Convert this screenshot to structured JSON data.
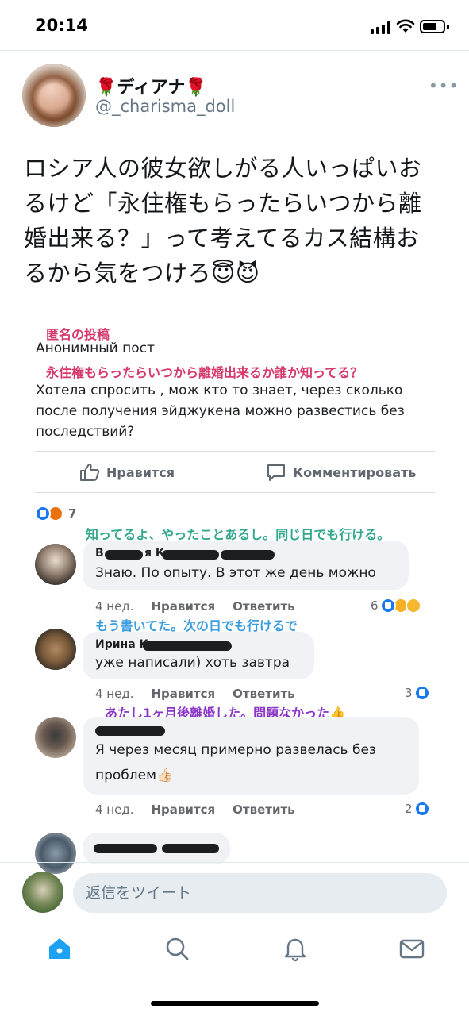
{
  "status": {
    "time": "20:14"
  },
  "tweet": {
    "name": "🌹ディアナ🌹",
    "handle": "@_charisma_doll",
    "more": "•••",
    "text_lines": [
      "ロシア人の彼女欲しがる人いっぱいお",
      "るけど「永住権もらったらいつから離",
      "婚出来る？」って考えてるカス結構お",
      "るから気をつけろ😇😈"
    ]
  },
  "embedded": {
    "anno_title": "匿名の投稿",
    "post_label": "Анонимный пост",
    "anno_question": "永住権もらったらいつから離婚出来るか誰か知ってる？",
    "post_lines": [
      "Хотела спросить , мож кто то знает, через сколько",
      "после получения эйджукена можно развестись без",
      "последствий?"
    ],
    "like_action": "Нравится",
    "comment_action": "Комментировать",
    "reaction_count": "7",
    "comments": [
      {
        "annotation": "知ってるよ、やったことあるし。同じ日でも行ける。",
        "name_visible": "В",
        "name_visible_2": "я К",
        "text_lines": [
          "Знаю. По опыту. В этот же день можно"
        ],
        "time": "4 нед.",
        "like": "Нравится",
        "reply": "Ответить",
        "count": "6"
      },
      {
        "annotation": "もう書いてた。次の日でも行けるで",
        "name_visible": "Ирина К",
        "text_lines": [
          "уже написали) хоть завтра"
        ],
        "time": "4 нед.",
        "like": "Нравится",
        "reply": "Ответить",
        "count": "3"
      },
      {
        "annotation": "あたし1ヶ月後離婚した。問題なかった👍",
        "text_lines": [
          "Я через месяц примерно развелась без",
          "проблем👍🏻"
        ],
        "time": "4 нед.",
        "like": "Нравится",
        "reply": "Ответить",
        "count": "2"
      }
    ]
  },
  "reply": {
    "placeholder": "返信をツイート"
  },
  "tabs": [
    "home-icon",
    "search-icon",
    "notifications-icon",
    "messages-icon"
  ],
  "colors": {
    "twitter_blue": "#1da1f2",
    "fb_blue": "#1877f2"
  }
}
